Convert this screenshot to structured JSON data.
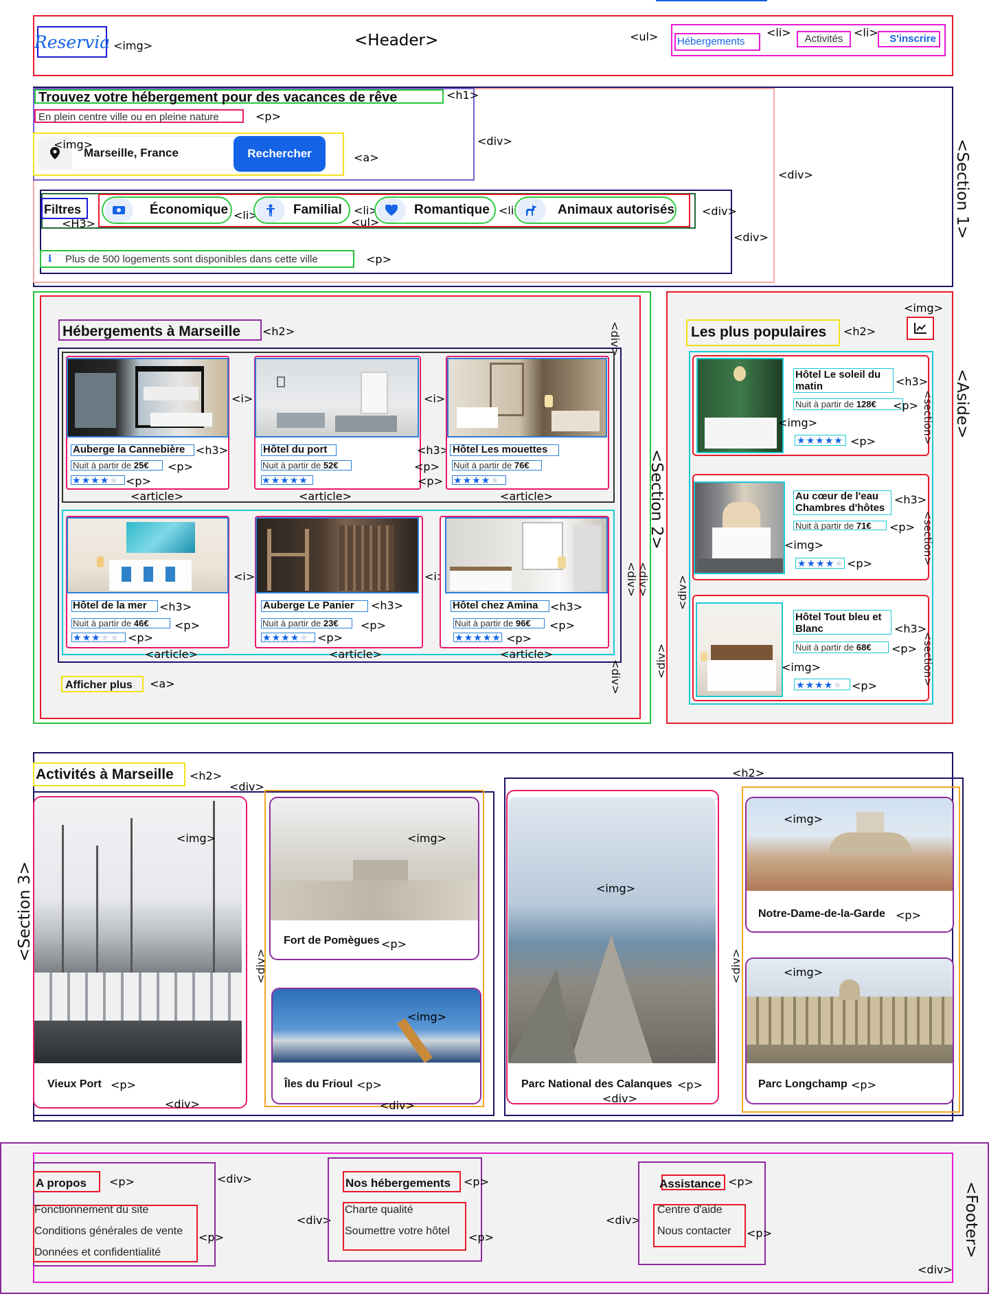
{
  "header": {
    "logo": "Reservia",
    "tag_label": "<Header>",
    "nav": [
      "Hébergements",
      "Activités",
      "S'inscrire"
    ]
  },
  "hero": {
    "title": "Trouvez votre hébergement pour des vacances de rêve",
    "subtitle": "En plein centre ville ou en pleine nature",
    "search_value": "Marseille, France",
    "search_button": "Rechercher",
    "filters_label": "Filtres",
    "filters": [
      "Économique",
      "Familial",
      "Romantique",
      "Animaux autorisés"
    ],
    "info": "Plus de 500 logements sont disponibles dans cette ville"
  },
  "hebergements": {
    "title": "Hébergements à Marseille",
    "more": "Afficher plus",
    "cards": [
      {
        "name": "Auberge la Cannebière",
        "price_prefix": "Nuit à partir de ",
        "price": "25€",
        "rating": 4
      },
      {
        "name": "Hôtel du port",
        "price_prefix": "Nuit à partir de ",
        "price": "52€",
        "rating": 5
      },
      {
        "name": "Hôtel Les mouettes",
        "price_prefix": "Nuit à partir de ",
        "price": "76€",
        "rating": 4
      },
      {
        "name": "Hôtel de la mer",
        "price_prefix": "Nuit à partir de ",
        "price": "46€",
        "rating": 3
      },
      {
        "name": "Auberge Le Panier",
        "price_prefix": "Nuit à partir de ",
        "price": "23€",
        "rating": 4
      },
      {
        "name": "Hôtel chez Amina",
        "price_prefix": "Nuit à partir de ",
        "price": "96€",
        "rating": 5
      }
    ]
  },
  "populaires": {
    "title": "Les plus populaires",
    "items": [
      {
        "name": "Hôtel Le soleil du matin",
        "price_prefix": "Nuit à partir de ",
        "price": "128€",
        "rating": 5
      },
      {
        "name": "Au cœur de l'eau Chambres d'hôtes",
        "price_prefix": "Nuit à partir de ",
        "price": "71€",
        "rating": 4
      },
      {
        "name": "Hôtel Tout bleu et Blanc",
        "price_prefix": "Nuit à partir de ",
        "price": "68€",
        "rating": 4
      }
    ]
  },
  "activites": {
    "title": "Activités à Marseille",
    "items": [
      "Vieux Port",
      "Fort de Pomègues",
      "Îles du Frioul",
      "Parc National des Calanques",
      "Notre-Dame-de-la-Garde",
      "Parc Longchamp"
    ]
  },
  "footer": {
    "columns": [
      {
        "title": "A propos",
        "links": [
          "Fonctionnement du site",
          "Conditions générales de vente",
          "Données et confidentialité"
        ]
      },
      {
        "title": "Nos hébergements",
        "links": [
          "Charte qualité",
          "Soumettre votre hôtel"
        ]
      },
      {
        "title": "Assistance",
        "links": [
          "Centre d'aide",
          "Nous contacter"
        ]
      }
    ]
  },
  "annotations": {
    "img": "<img>",
    "ul": "<ul>",
    "li": "<li>",
    "h1": "<h1>",
    "h2": "<h2>",
    "h3": "<h3>",
    "p": "<p>",
    "a": "<a>",
    "div": "<div>",
    "i": "<i>",
    "article": "<article>",
    "section": "<section>",
    "H3": "<H3>",
    "section1": "<Section 1>",
    "section2": "<Section 2>",
    "section3": "<Section 3>",
    "aside": "<Aside>",
    "footer": "<Footer>"
  },
  "colors": {
    "accent": "#1463e6",
    "page_bg": "#ffffff",
    "panel_bg": "#f2f2f2",
    "outline_red": "#e8192c",
    "outline_navy": "#1b1464",
    "outline_magenta": "#e81ad4",
    "outline_green": "#27c23c",
    "outline_cyan": "#19c9d6",
    "outline_yellow": "#f2e21a",
    "outline_orange": "#f5a623",
    "outline_pink": "#e8196c"
  }
}
